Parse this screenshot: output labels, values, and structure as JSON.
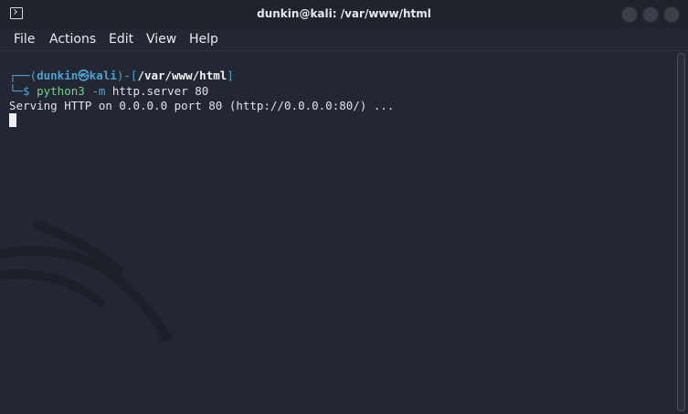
{
  "window": {
    "title": "dunkin@kali: /var/www/html"
  },
  "menu": {
    "file": "File",
    "actions": "Actions",
    "edit": "Edit",
    "view": "View",
    "help": "Help"
  },
  "terminal": {
    "prompt_open": "┌──(",
    "prompt_user": "dunkin㉿kali",
    "prompt_mid": ")-[",
    "prompt_path": "/var/www/html",
    "prompt_close": "]",
    "prompt_second": "└─$ ",
    "command": "python3",
    "flag": " -m",
    "args": " http.server 80",
    "output": "Serving HTTP on 0.0.0.0 port 80 (http://0.0.0.0:80/) ..."
  },
  "colors": {
    "background": "#232733",
    "prompt_blue": "#4aa3cf",
    "command_green": "#6fd28a"
  }
}
